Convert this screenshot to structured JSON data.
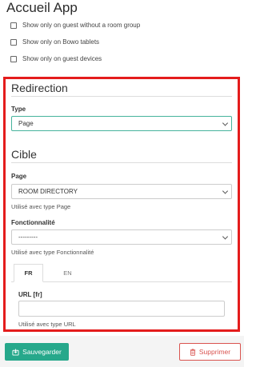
{
  "page": {
    "title": "Accueil App"
  },
  "checkboxes": [
    {
      "label": "Show only on guest without a room group",
      "checked": false
    },
    {
      "label": "Show only on Bowo tablets",
      "checked": false
    },
    {
      "label": "Show only on guest devices",
      "checked": false
    }
  ],
  "redirection": {
    "heading": "Redirection",
    "type_label": "Type",
    "type_value": "Page"
  },
  "cible": {
    "heading": "Cible",
    "page_label": "Page",
    "page_value": "ROOM DIRECTORY",
    "page_help": "Utilisé avec type Page",
    "fonction_label": "Fonctionnalité",
    "fonction_value": "---------",
    "fonction_help": "Utilisé avec type Fonctionnalité"
  },
  "lang_tabs": [
    {
      "label": "FR",
      "active": true
    },
    {
      "label": "EN",
      "active": false
    }
  ],
  "url": {
    "label": "URL [fr]",
    "value": "",
    "help": "Utilisé avec type URL"
  },
  "footer": {
    "save_label": "Sauvegarder",
    "delete_label": "Supprimer"
  },
  "colors": {
    "accent": "#26a88b",
    "danger": "#d9534f",
    "highlight_frame": "#e41c1c"
  }
}
